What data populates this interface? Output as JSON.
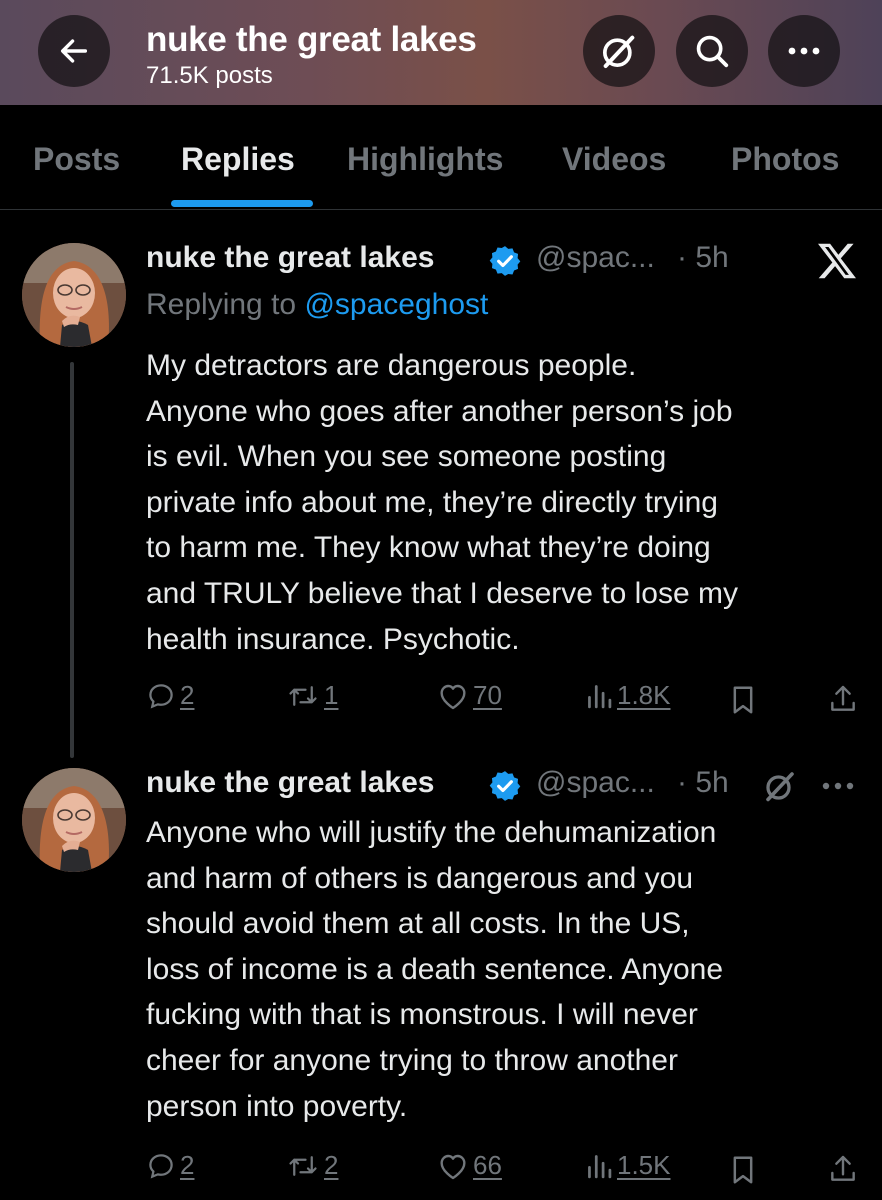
{
  "header": {
    "title": "nuke the great lakes",
    "post_count": "71.5K posts",
    "icons": [
      "back-arrow-icon",
      "grok-icon",
      "search-icon",
      "more-icon"
    ]
  },
  "tabs": [
    {
      "label": "Posts",
      "active": false
    },
    {
      "label": "Replies",
      "active": true
    },
    {
      "label": "Highlights",
      "active": false
    },
    {
      "label": "Videos",
      "active": false
    },
    {
      "label": "Photos",
      "active": false
    }
  ],
  "colors": {
    "accent": "#1d9bf0",
    "text": "#e7e9ea",
    "muted": "#71767b",
    "background": "#000000"
  },
  "tweets": [
    {
      "name": "nuke the great lakes",
      "handle": "@spac...",
      "time": "· 5h",
      "replying_prefix": "Replying to",
      "replying_to": "@spaceghost",
      "body": "My detractors are dangerous people.\nAnyone who goes after another person’s job\nis evil. When you see someone posting\nprivate info about me, they’re directly trying\nto harm me. They know what they’re doing\nand TRULY believe that I deserve to lose my\nhealth insurance. Psychotic.",
      "replies": "2",
      "reposts": "1",
      "likes": "70",
      "views": "1.8K"
    },
    {
      "name": "nuke the great lakes",
      "handle": "@spac...",
      "time": "· 5h",
      "body": "Anyone who will justify the dehumanization\nand harm of others is dangerous and you\nshould avoid them at all costs. In the US,\nloss of income is a death sentence. Anyone\nfucking with that is monstrous. I will never\ncheer for anyone trying to throw another\nperson into poverty.",
      "replies": "2",
      "reposts": "2",
      "likes": "66",
      "views": "1.5K"
    }
  ]
}
